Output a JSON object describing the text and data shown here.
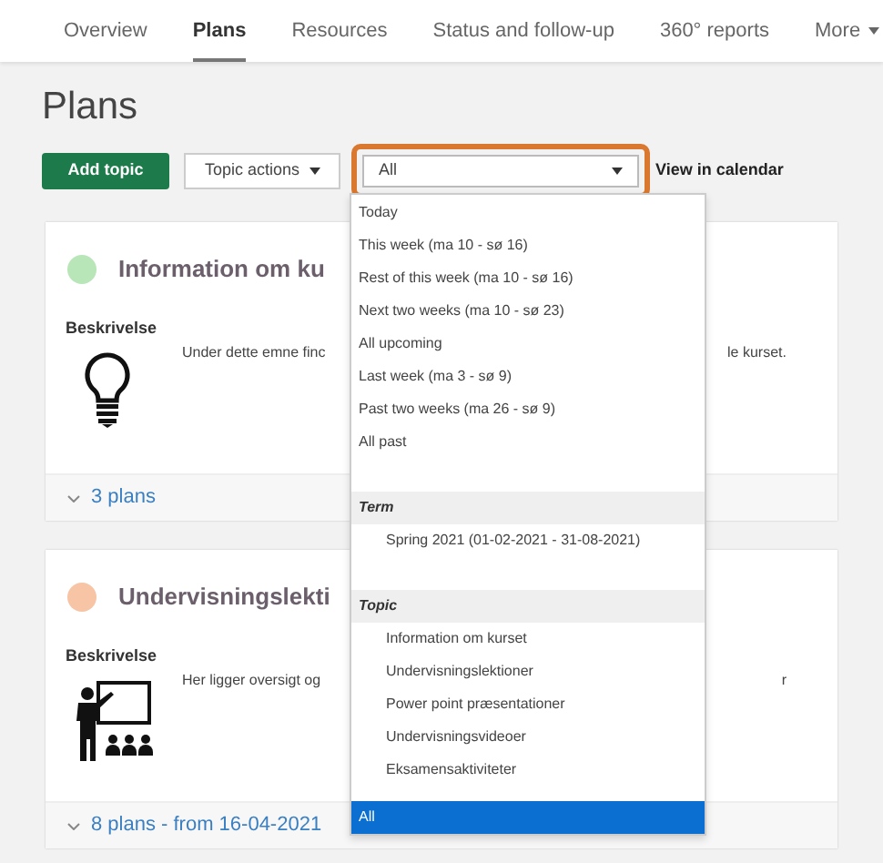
{
  "tabs": [
    {
      "label": "Overview",
      "selected": false
    },
    {
      "label": "Plans",
      "selected": true
    },
    {
      "label": "Resources",
      "selected": false
    },
    {
      "label": "Status and follow-up",
      "selected": false
    },
    {
      "label": "360° reports",
      "selected": false
    },
    {
      "label": "More",
      "selected": false
    }
  ],
  "page_title": "Plans",
  "toolbar": {
    "add_button": "Add topic",
    "actions_button": "Topic actions",
    "filter_select": {
      "value": "All",
      "highlighted": true
    },
    "calendar_link": "View in calendar"
  },
  "dropdown": [
    {
      "kind": "option",
      "label": "Today",
      "selected": false
    },
    {
      "kind": "option",
      "label": "This week (ma 10 - sø 16)",
      "selected": false
    },
    {
      "kind": "option",
      "label": "Rest of this week (ma 10 - sø 16)",
      "selected": false
    },
    {
      "kind": "option",
      "label": "Next two weeks (ma 10 - sø 23)",
      "selected": false
    },
    {
      "kind": "option",
      "label": "All upcoming",
      "selected": false
    },
    {
      "kind": "option",
      "label": "Last week (ma 3 - sø 9)",
      "selected": false
    },
    {
      "kind": "option",
      "label": "Past two weeks (ma 26 - sø 9)",
      "selected": false
    },
    {
      "kind": "option",
      "label": "All past",
      "selected": false
    },
    {
      "kind": "header",
      "label": "Term"
    },
    {
      "kind": "suboption",
      "label": "Spring 2021 (01-02-2021 - 31-08-2021)",
      "selected": false
    },
    {
      "kind": "header",
      "label": "Topic"
    },
    {
      "kind": "suboption",
      "label": "Information om kurset",
      "selected": false
    },
    {
      "kind": "suboption",
      "label": "Undervisningslektioner",
      "selected": false
    },
    {
      "kind": "suboption",
      "label": "Power point præsentationer",
      "selected": false
    },
    {
      "kind": "suboption",
      "label": "Undervisningsvideoer",
      "selected": false
    },
    {
      "kind": "suboption",
      "label": "Eksamensaktiviteter",
      "selected": false
    },
    {
      "kind": "option",
      "label": "All",
      "selected": true
    }
  ],
  "cards": [
    {
      "color": "#b8e6b8",
      "title": "Information om ku",
      "label": "Beskrivelse",
      "description": "Under dette emne finc",
      "description_tail": "le kurset.",
      "footer": "3 plans"
    },
    {
      "color": "#f7c4a5",
      "title": "Undervisningslekti",
      "label": "Beskrivelse",
      "description": "Her ligger oversigt og",
      "description_tail": "r",
      "footer": "8 plans - from 16-04-2021"
    }
  ]
}
